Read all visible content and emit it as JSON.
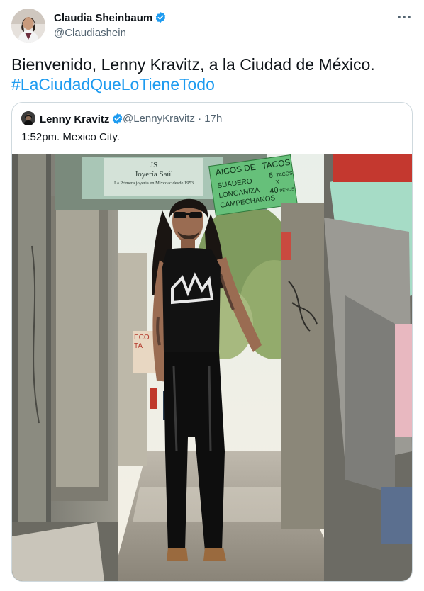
{
  "author": {
    "name": "Claudia Sheinbaum",
    "handle": "@Claudiashein",
    "avatar_icon": "person-avatar-icon"
  },
  "more_icon": "more-horizontal-icon",
  "tweet": {
    "text": "Bienvenido, Lenny Kravitz, a la Ciudad de México.",
    "hashtag": "#LaCiudadQueLoTieneTodo"
  },
  "quoted_tweet": {
    "name": "Lenny Kravitz",
    "handle": "@LennyKravitz",
    "separator": "·",
    "time": "17h",
    "text": "1:52pm. Mexico City.",
    "image_icon": "street-photo-image",
    "photo_signs": {
      "jewelry_top": "JS",
      "jewelry_name": "Joyería Saúl",
      "jewelry_tagline": "La Primera joyería en Mixcoac desde 1953",
      "tacos_title_1": "AICOS DE",
      "tacos_title_2": "TACOS",
      "tacos_5": "5",
      "tacos_tacos": "TACOS",
      "tacos_x": "X",
      "tacos_40": "40",
      "tacos_pesos": "PESOS",
      "tacos_line_1": "SUADERO",
      "tacos_line_2": "LONGANIZA",
      "tacos_line_3": "CAMPECHANOS",
      "shop_eco": "ECO",
      "shop_ta": "TA"
    }
  },
  "colors": {
    "link": "#1d9bf0",
    "secondary": "#536471",
    "verified": "#1d9bf0",
    "border": "#cfd9de"
  }
}
